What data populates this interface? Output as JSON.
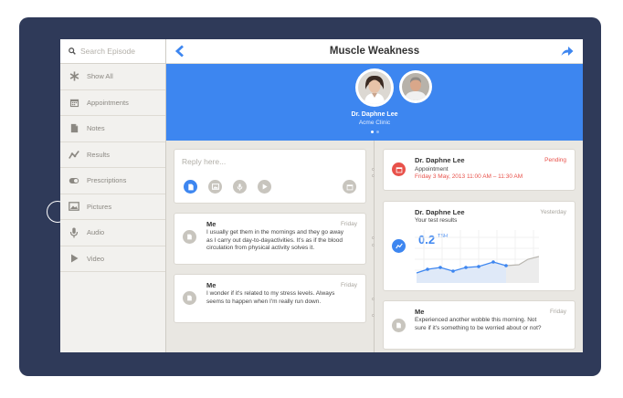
{
  "header": {
    "title": "Muscle Weakness"
  },
  "search": {
    "placeholder": "Search Episode"
  },
  "sidebar": {
    "items": [
      {
        "label": "Show All",
        "icon": "asterisk-icon"
      },
      {
        "label": "Appointments",
        "icon": "calendar-icon"
      },
      {
        "label": "Notes",
        "icon": "note-icon"
      },
      {
        "label": "Results",
        "icon": "chart-line-icon"
      },
      {
        "label": "Prescriptions",
        "icon": "pill-icon"
      },
      {
        "label": "Pictures",
        "icon": "picture-icon"
      },
      {
        "label": "Audio",
        "icon": "microphone-icon"
      },
      {
        "label": "Video",
        "icon": "play-icon"
      }
    ]
  },
  "profile": {
    "name": "Dr. Daphne Lee",
    "clinic": "Acme Clinic"
  },
  "reply": {
    "placeholder": "Reply here..."
  },
  "left_feed": [
    {
      "author": "Me",
      "time": "Friday",
      "lines": [
        "I usually get them in the mornings and they go away",
        "as I carry out day-to-dayactivities. It's as if the blood",
        "circulation from physical activity solves it."
      ]
    },
    {
      "author": "Me",
      "time": "Friday",
      "lines": [
        "I wonder if it's related to my stress levels. Always",
        "seems to happen when I'm really run down."
      ]
    }
  ],
  "right_feed": {
    "appointment": {
      "author": "Dr. Daphne Lee",
      "status": "Pending",
      "type": "Appointment",
      "date": "Friday 3 May, 2013 11:00 AM – 11:30 AM"
    },
    "result": {
      "author": "Dr. Daphne Lee",
      "time": "Yesterday",
      "subtitle": "Your test results",
      "value": "0.2",
      "unit": "TSH"
    },
    "message": {
      "author": "Me",
      "time": "Friday",
      "lines": [
        "Experienced another wobble this morning. Not",
        "sure if it's something to be worried about or not?"
      ]
    }
  },
  "colors": {
    "accent": "#3d86f0",
    "pending": "#e8514a",
    "frame": "#2f3a59"
  }
}
